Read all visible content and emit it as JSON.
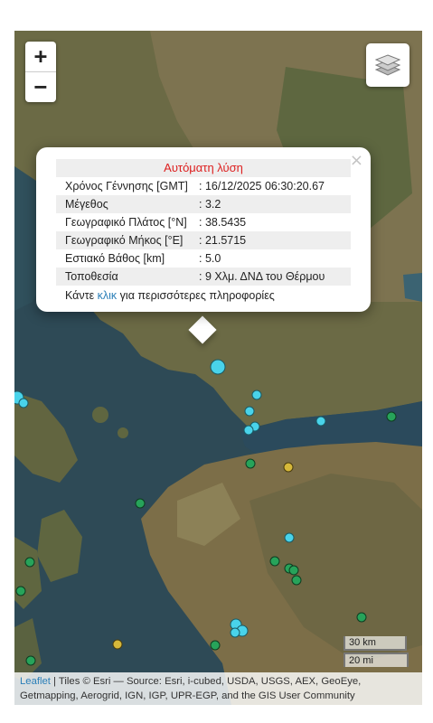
{
  "map": {
    "zoom_in": "+",
    "zoom_out": "−",
    "layers_icon": "layers-icon"
  },
  "popup": {
    "close": "×",
    "title": "Αυτόματη λύση",
    "rows": [
      {
        "label": "Χρόνος Γέννησης [GMT]",
        "value": ": 16/12/2025 06:30:20.67"
      },
      {
        "label": "Μέγεθος",
        "value": ": 3.2"
      },
      {
        "label": "Γεωγραφικό Πλάτος [°N]",
        "value": ": 38.5435"
      },
      {
        "label": "Γεωγραφικό Μήκος [°E]",
        "value": ": 21.5715"
      },
      {
        "label": "Εστιακό Βάθος [km]",
        "value": ": 5.0"
      },
      {
        "label": "Τοποθεσία",
        "value": ": 9 Χλμ. ΔΝΔ του Θέρμου"
      }
    ],
    "more_prefix": "Κάντε ",
    "more_link": "κλικ",
    "more_suffix": " για περισσότερες πληροφορίες"
  },
  "scale": {
    "km": "30 km",
    "mi": "20 mi"
  },
  "attribution": {
    "leaflet": "Leaflet",
    "rest": " | Tiles © Esri — Source: Esri, i-cubed, USDA, USGS, AEX, GeoEye, Getmapping, Aerogrid, IGN, IGP, UPR-EGP, and the GIS User Community"
  },
  "colors": {
    "marker_green": "#27a35a",
    "marker_cyan": "#49d3ea",
    "marker_yellow": "#d6b83a",
    "popup_title": "#dd1f1f"
  }
}
